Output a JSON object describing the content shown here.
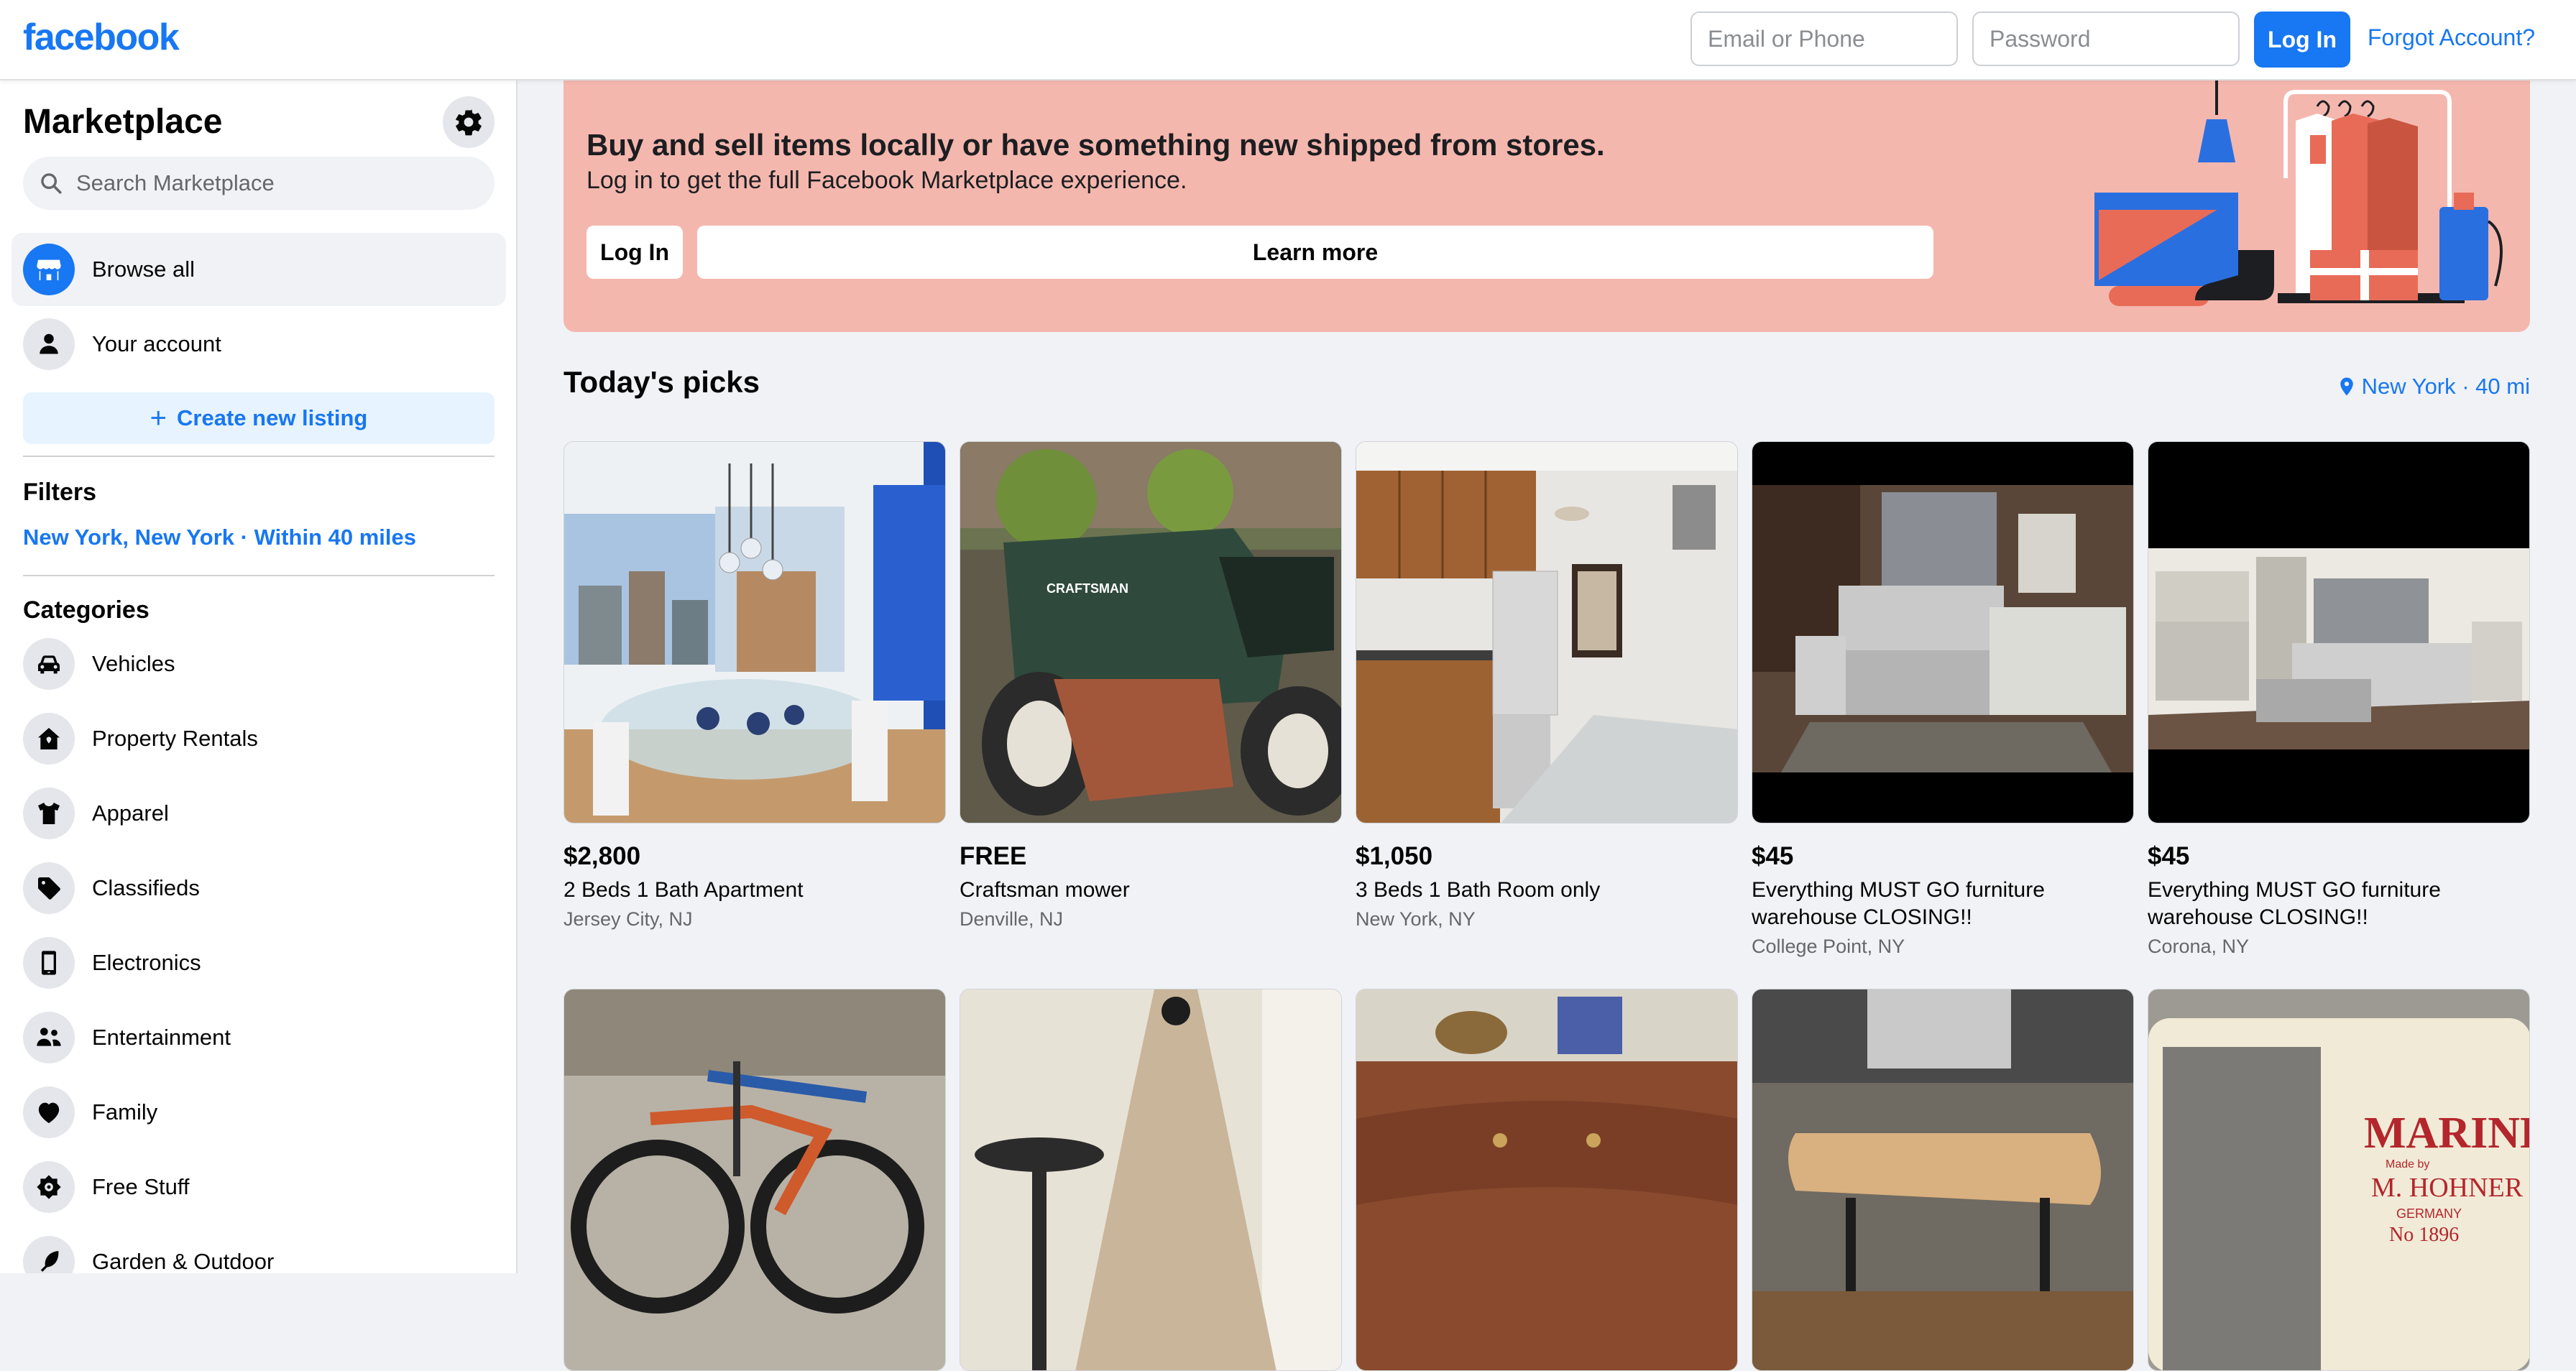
{
  "header": {
    "logo": "facebook",
    "email_placeholder": "Email or Phone",
    "password_placeholder": "Password",
    "login_label": "Log In",
    "forgot_label": "Forgot Account?"
  },
  "sidebar": {
    "title": "Marketplace",
    "search_placeholder": "Search Marketplace",
    "nav": [
      {
        "label": "Browse all",
        "icon": "storefront-icon"
      },
      {
        "label": "Your account",
        "icon": "person-icon"
      }
    ],
    "create_label": "Create new listing",
    "filters_title": "Filters",
    "filter_location": "New York, New York · Within 40 miles",
    "categories_title": "Categories",
    "categories": [
      {
        "label": "Vehicles",
        "icon": "car-icon"
      },
      {
        "label": "Property Rentals",
        "icon": "house-icon"
      },
      {
        "label": "Apparel",
        "icon": "shirt-icon"
      },
      {
        "label": "Classifieds",
        "icon": "tag-icon"
      },
      {
        "label": "Electronics",
        "icon": "phone-icon"
      },
      {
        "label": "Entertainment",
        "icon": "people-icon"
      },
      {
        "label": "Family",
        "icon": "heart-icon"
      },
      {
        "label": "Free Stuff",
        "icon": "free-tag-icon"
      },
      {
        "label": "Garden & Outdoor",
        "icon": "leaf-icon"
      }
    ]
  },
  "banner": {
    "headline": "Buy and sell items locally or have something new shipped from stores.",
    "subtext": "Log in to get the full Facebook Marketplace experience.",
    "login_label": "Log In",
    "learn_label": "Learn more"
  },
  "picks": {
    "title": "Today's picks",
    "location": "New York · 40 mi",
    "items": [
      {
        "price": "$2,800",
        "title": "2 Beds 1 Bath Apartment",
        "location": "Jersey City, NJ"
      },
      {
        "price": "FREE",
        "title": "Craftsman mower",
        "location": "Denville, NJ"
      },
      {
        "price": "$1,050",
        "title": "3 Beds 1 Bath Room only",
        "location": "New York, NY"
      },
      {
        "price": "$45",
        "title": "Everything MUST GO furniture warehouse CLOSING!!",
        "location": "College Point, NY"
      },
      {
        "price": "$45",
        "title": "Everything MUST GO furniture warehouse CLOSING!!",
        "location": "Corona, NY"
      }
    ],
    "row2_text": {
      "harmonica_brand": "MARINE BAND",
      "harmonica_maker": "M. HOHNER",
      "harmonica_no": "No 1896",
      "mower_brand": "CRAFTSMAN"
    }
  },
  "colors": {
    "brand": "#1877f2",
    "banner_bg": "#f4b7ae",
    "page_bg": "#f0f2f5"
  }
}
